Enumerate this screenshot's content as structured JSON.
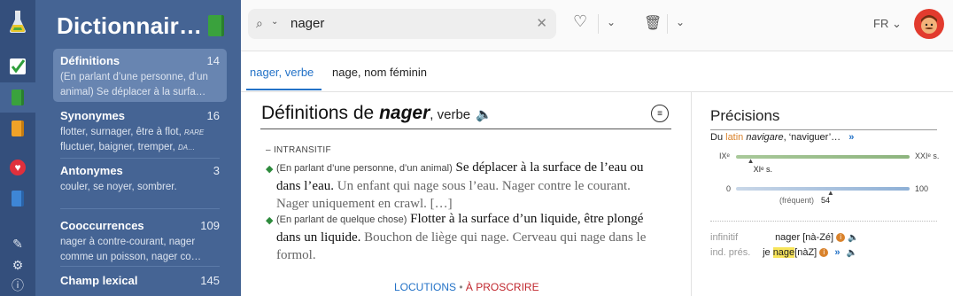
{
  "sidebar": {
    "title": "Dictionnair…",
    "items": [
      {
        "label": "Définitions",
        "count": "14",
        "sub": "(En parlant d’une personne, d’un animal) Se déplacer à la surfa…"
      },
      {
        "label": "Synonymes",
        "count": "16",
        "sub1": "flotter, surnager, être à flot,",
        "sub1_tag": "RARE",
        "sub2": "fluctuer, baigner, tremper,",
        "sub2_tag": "DA…"
      },
      {
        "label": "Antonymes",
        "count": "3",
        "sub": "couler, se noyer, sombrer."
      },
      {
        "label": "Cooccurrences",
        "count": "109",
        "sub": "nager à contre-courant, nager comme un poisson, nager co…"
      },
      {
        "label": "Champ lexical",
        "count": "145"
      }
    ]
  },
  "search": {
    "value": "nager",
    "language": "FR"
  },
  "tabs": [
    "nager, verbe",
    "nage, nom féminin"
  ],
  "definition": {
    "title_prefix": "Définitions de",
    "word": "nager",
    "pos": ", verbe",
    "grammar": "– INTRANSITIF",
    "senses": [
      {
        "domain": "(En parlant d’une personne, d’un animal)",
        "text": "Se déplacer à la surface de l’eau ou dans l’eau.",
        "example": "Un enfant qui nage sous l’eau. Nager contre le courant. Nager uniquement en crawl. […]"
      },
      {
        "domain": "(En parlant de quelque chose)",
        "text": "Flotter à la surface d’un liquide, être plongé dans un liquide.",
        "example": "Bouchon de liège qui nage. Cerveau qui nage dans le formol."
      }
    ],
    "links": {
      "locutions": "LOCUTIONS",
      "sep": "•",
      "proscrire": "À PROSCRIRE"
    }
  },
  "precisions": {
    "title": "Précisions",
    "etym_prefix": "Du",
    "etym_lang": "latin",
    "etym_word": "navigare",
    "etym_rest": ", ‘naviguer’…",
    "etym_more": "»",
    "era_start": "IXᵉ",
    "era_end": "XXIᵉ s.",
    "era_value": "XIᵉ s.",
    "era_fraction": 0.08,
    "freq_min": "0",
    "freq_max": "100",
    "freq_label": "(fréquent)",
    "freq_value": 54,
    "freq_value_text": "54",
    "infinitif_label": "infinitif",
    "infinitif_value": "nager [nà-Zé]",
    "ind_label": "ind. prés.",
    "ind_pron": "je",
    "ind_value": "nage",
    "ind_phon": "[nàZ]"
  },
  "colors": {
    "accent": "#2372c7",
    "sidebar": "#456494",
    "rail": "#344f7c",
    "highlight": "#f7e45b"
  }
}
